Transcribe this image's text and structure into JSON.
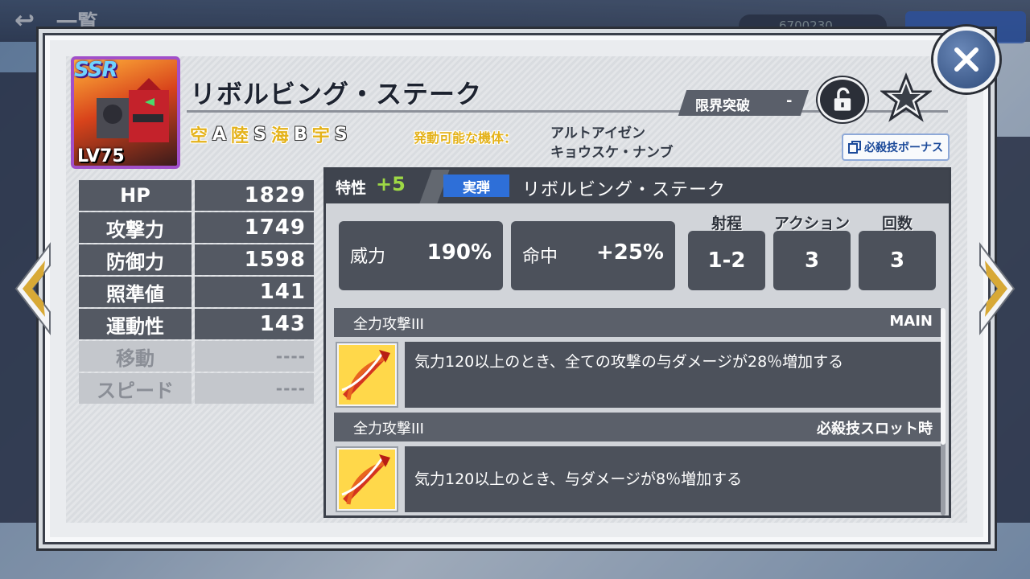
{
  "background": {
    "title": "一覧",
    "currency": "6700230"
  },
  "unit": {
    "rarity": "SSR",
    "level": "LV75"
  },
  "weapon": {
    "name": "リボルビング・ステーク",
    "terrain": [
      {
        "label": "空",
        "rank": "A"
      },
      {
        "label": "陸",
        "rank": "S"
      },
      {
        "label": "海",
        "rank": "B"
      },
      {
        "label": "宇",
        "rank": "S"
      }
    ],
    "units_label": "発動可能な機体：",
    "units": [
      "アルトアイゼン",
      "キョウスケ・ナンブ"
    ],
    "limit_break_label": "限界突破",
    "limit_break_value": "-",
    "bonus_button": "必殺技ボーナス"
  },
  "stats": [
    {
      "label": "HP",
      "value": "1829"
    },
    {
      "label": "攻撃力",
      "value": "1749"
    },
    {
      "label": "防御力",
      "value": "1598"
    },
    {
      "label": "照準値",
      "value": "141"
    },
    {
      "label": "運動性",
      "value": "143"
    },
    {
      "label": "移動",
      "value": "----"
    },
    {
      "label": "スピード",
      "value": "----"
    }
  ],
  "detail": {
    "trait_label": "特性",
    "trait_value": "+5",
    "type_badge": "実弾",
    "title": "リボルビング・ステーク",
    "power_label": "威力",
    "power_value": "190%",
    "hit_label": "命中",
    "hit_value": "+25%",
    "range_label": "射程",
    "range_value": "1-2",
    "action_label": "アクション",
    "action_value": "3",
    "count_label": "回数",
    "count_value": "3"
  },
  "skills": [
    {
      "name": "全力攻撃III",
      "tag": "MAIN",
      "desc": "気力120以上のとき、全ての攻撃の与ダメージが28％増加する"
    },
    {
      "name": "全力攻撃III",
      "tag": "必殺技スロット時",
      "desc": "気力120以上のとき、与ダメージが8％増加する"
    }
  ],
  "colors": {
    "accent_blue": "#2e6fd8",
    "trait_green": "#9ed945",
    "terrain_gold": "#e4b21a",
    "panel_dark": "#4c515b"
  }
}
